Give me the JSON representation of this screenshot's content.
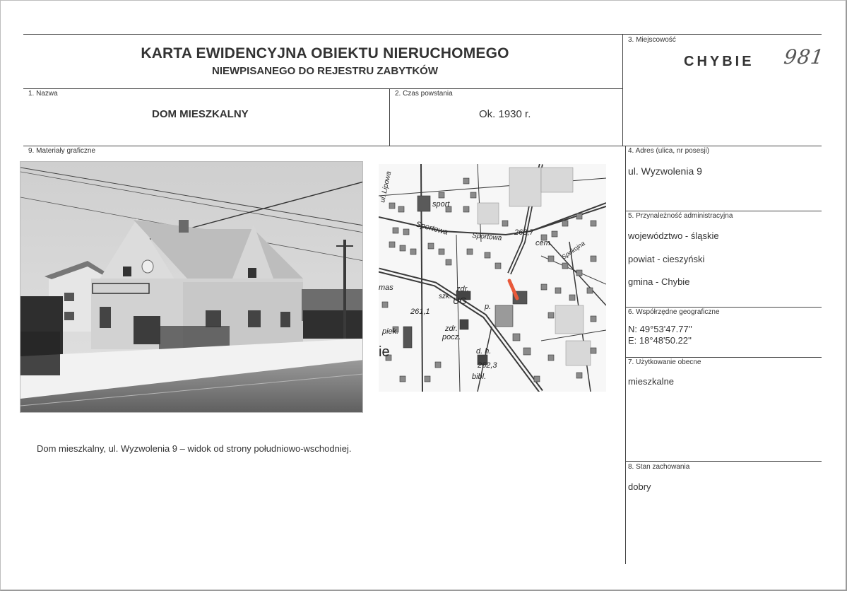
{
  "header": {
    "title": "KARTA EWIDENCYJNA OBIEKTU NIERUCHOMEGO",
    "subtitle": "NIEWPISANEGO DO REJESTRU ZABYTKÓW"
  },
  "fields": {
    "nazwa": {
      "label": "1. Nazwa",
      "value": "DOM MIESZKALNY"
    },
    "czas": {
      "label": "2. Czas powstania",
      "value": "Ok. 1930 r."
    },
    "miejscowosc": {
      "label": "3. Miejscowość",
      "value": "CHYBIE",
      "handwritten_number": "981"
    },
    "adres": {
      "label": "4. Adres (ulica, nr posesji)",
      "value": "ul. Wyzwolenia 9"
    },
    "przynaleznosc": {
      "label": "5. Przynależność administracyjna",
      "wojewodztwo": "województwo - śląskie",
      "powiat": "powiat - cieszyński",
      "gmina": "gmina - Chybie"
    },
    "wspolrzedne": {
      "label": "6. Współrzędne geograficzne",
      "n": "N: 49°53'47.77''",
      "e": "E: 18°48'50.22''"
    },
    "uzytkowanie": {
      "label": "7. Użytkowanie obecne",
      "value": "mieszkalne"
    },
    "stan": {
      "label": "8. Stan zachowania",
      "value": "dobry"
    },
    "materialy": {
      "label": "9. Materiały graficzne",
      "caption": "Dom mieszkalny, ul. Wyzwolenia 9 – widok od strony południowo-wschodniej."
    }
  },
  "map": {
    "labels": {
      "lipowa": "ul. Lipowa",
      "sport": "sport",
      "sportowa": "Sportowa",
      "sportowa2": "Sportowa",
      "elev1": "260,7",
      "cem": "cem.",
      "spokojna": "Spokojna",
      "mas": "mas",
      "szk": "szk.",
      "zdr": "zdr.",
      "ug": "UG",
      "p": "p.",
      "elev2": "261,1",
      "zdr2": "zdr.",
      "pocz": "pocz.",
      "piek": "piek.",
      "ie": "ie",
      "dh": "d. h.",
      "elev3": "262,3",
      "bibl": "bibl."
    },
    "colors": {
      "marker": "#e8593a",
      "roads": "#3a3a3a",
      "blocks": "#8a8a8a"
    }
  },
  "colors": {
    "lines": "#444444",
    "text": "#333333"
  }
}
